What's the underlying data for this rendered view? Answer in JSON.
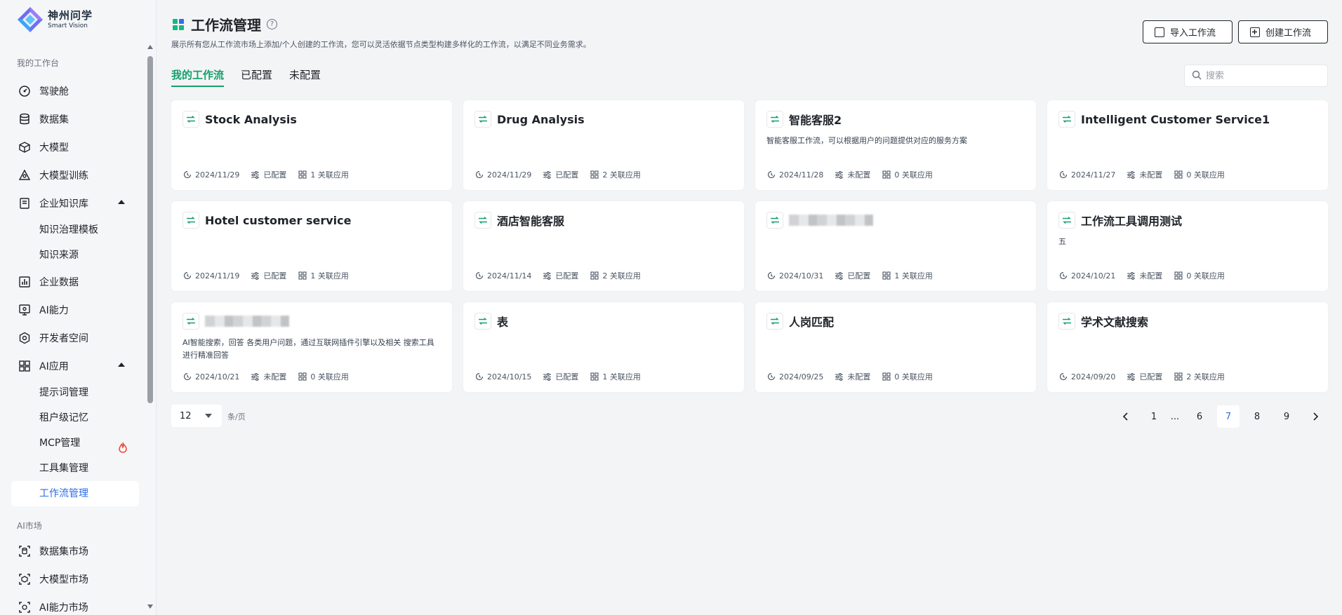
{
  "brand": {
    "name_cn": "神州问学",
    "name_en": "Smart Vision"
  },
  "sidebar": {
    "sections": {
      "workbench": "我的工作台",
      "market": "AI市场"
    },
    "items": [
      {
        "label": "驾驶舱",
        "icon": "dashboard-icon"
      },
      {
        "label": "数据集",
        "icon": "database-icon"
      },
      {
        "label": "大模型",
        "icon": "cube-icon"
      },
      {
        "label": "大模型训练",
        "icon": "training-icon"
      },
      {
        "label": "企业知识库",
        "icon": "knowledge-icon",
        "expanded": true
      },
      {
        "label": "企业数据",
        "icon": "chart-icon"
      },
      {
        "label": "AI能力",
        "icon": "ai-capability-icon"
      },
      {
        "label": "开发者空间",
        "icon": "developer-icon"
      },
      {
        "label": "AI应用",
        "icon": "apps-icon",
        "expanded": true
      }
    ],
    "knowledge_sub": [
      "知识治理模板",
      "知识来源"
    ],
    "app_sub": [
      "提示词管理",
      "租户级记忆",
      "MCP管理",
      "工具集管理",
      "工作流管理"
    ],
    "market_items": [
      {
        "label": "数据集市场",
        "icon": "dataset-market-icon"
      },
      {
        "label": "大模型市场",
        "icon": "model-market-icon"
      },
      {
        "label": "AI能力市场",
        "icon": "ai-market-icon"
      }
    ]
  },
  "header": {
    "title": "工作流管理",
    "description": "展示所有您从工作流市场上添加/个人创建的工作流，您可以灵活依据节点类型构建多样化的工作流，以满足不同业务需求。",
    "import_label": "导入工作流",
    "create_label": "创建工作流"
  },
  "tabs": [
    "我的工作流",
    "已配置",
    "未配置"
  ],
  "search": {
    "placeholder": "搜索"
  },
  "cards": [
    {
      "title": "Stock Analysis",
      "desc": "",
      "date": "2024/11/29",
      "status": "已配置",
      "apps": "1 关联应用",
      "blurred": false
    },
    {
      "title": "Drug Analysis",
      "desc": "",
      "date": "2024/11/29",
      "status": "已配置",
      "apps": "2 关联应用",
      "blurred": false
    },
    {
      "title": "智能客服2",
      "desc": "智能客服工作流，可以根据用户的问题提供对应的服务方案",
      "date": "2024/11/28",
      "status": "未配置",
      "apps": "0 关联应用",
      "blurred": false
    },
    {
      "title": "Intelligent Customer Service1",
      "desc": "",
      "date": "2024/11/27",
      "status": "未配置",
      "apps": "0 关联应用",
      "blurred": false
    },
    {
      "title": "Hotel customer service",
      "desc": "",
      "date": "2024/11/19",
      "status": "已配置",
      "apps": "1 关联应用",
      "blurred": false
    },
    {
      "title": "酒店智能客服",
      "desc": "",
      "date": "2024/11/14",
      "status": "已配置",
      "apps": "2 关联应用",
      "blurred": false
    },
    {
      "title": "",
      "desc": "",
      "date": "2024/10/31",
      "status": "已配置",
      "apps": "1 关联应用",
      "blurred": true
    },
    {
      "title": "工作流工具调用测试",
      "desc": "五",
      "date": "2024/10/21",
      "status": "未配置",
      "apps": "0 关联应用",
      "blurred": false
    },
    {
      "title": "",
      "desc": "AI智能搜索，回答 各类用户问题，通过互联网插件引擎以及相关 搜索工具 进行精准回答",
      "date": "2024/10/21",
      "status": "未配置",
      "apps": "0 关联应用",
      "blurred": true
    },
    {
      "title": "表",
      "desc": "",
      "date": "2024/10/15",
      "status": "已配置",
      "apps": "1 关联应用",
      "blurred": false
    },
    {
      "title": "人岗匹配",
      "desc": "",
      "date": "2024/09/25",
      "status": "未配置",
      "apps": "0 关联应用",
      "blurred": false
    },
    {
      "title": "学术文献搜索",
      "desc": "",
      "date": "2024/09/20",
      "status": "已配置",
      "apps": "2 关联应用",
      "blurred": false
    }
  ],
  "pagination": {
    "page_size": "12",
    "per_page_label": "条/页",
    "pages": [
      "1",
      "...",
      "6",
      "7",
      "8",
      "9"
    ],
    "current": "7"
  },
  "colors": {
    "accent_green": "#14a06b",
    "accent_blue": "#2b6de8",
    "fire": "#f04438"
  }
}
